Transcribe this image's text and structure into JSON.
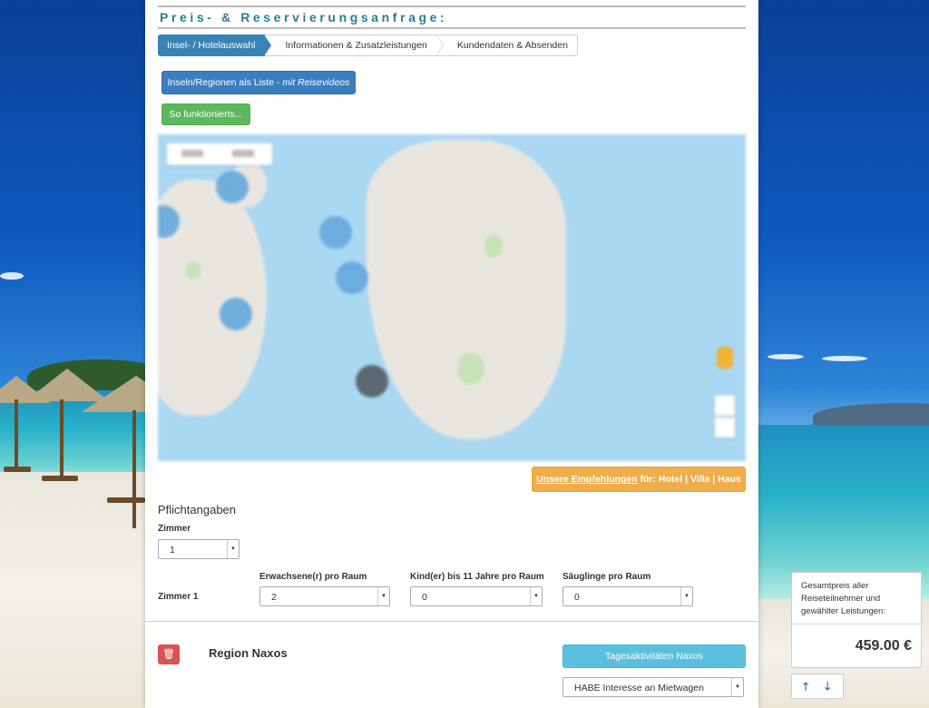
{
  "form": {
    "title": "Preis- & Reservierungsanfrage:",
    "steps": [
      {
        "label": "Insel- / Hotelauswahl"
      },
      {
        "label": "Informationen & Zusatzleistungen"
      },
      {
        "label": "Kundendaten & Absenden"
      }
    ],
    "islands_button": {
      "label": "Inseln/Regionen als Liste - ",
      "italic": "mit Reisevideos"
    },
    "howto_button": "So funktionierts...",
    "recommend_button": {
      "link": "Unsere Empfehlungen",
      "rest": " für: Hotel | Villa | Haus"
    },
    "section_title": "Pflichtangaben",
    "rooms_label": "Zimmer",
    "rooms_value": "1",
    "room_row_label": "Zimmer 1",
    "adults_label": "Erwachsene(r) pro Raum",
    "adults_value": "2",
    "children_label": "Kind(er) bis 11 Jahre pro Raum",
    "children_value": "0",
    "infants_label": "Säuglinge pro Raum",
    "infants_value": "0",
    "region_title": "Region Naxos",
    "activities_button": "Tagesaktivitäten Naxos",
    "car_select_value": "HABE Interesse an Mietwagen"
  },
  "price": {
    "label": "Gesamtpreis aller Reiseteilnehmer und gewählter Leistungen:",
    "value": "459.00 €"
  },
  "icons": {
    "trash": "trash-icon",
    "up": "arrow-up-icon",
    "down": "arrow-down-icon"
  },
  "colors": {
    "primary": "#3a83b6",
    "success": "#5cb85c",
    "warning": "#f0ad4e",
    "danger": "#d9534f",
    "info": "#5bc0de",
    "title": "#2a7c97"
  }
}
